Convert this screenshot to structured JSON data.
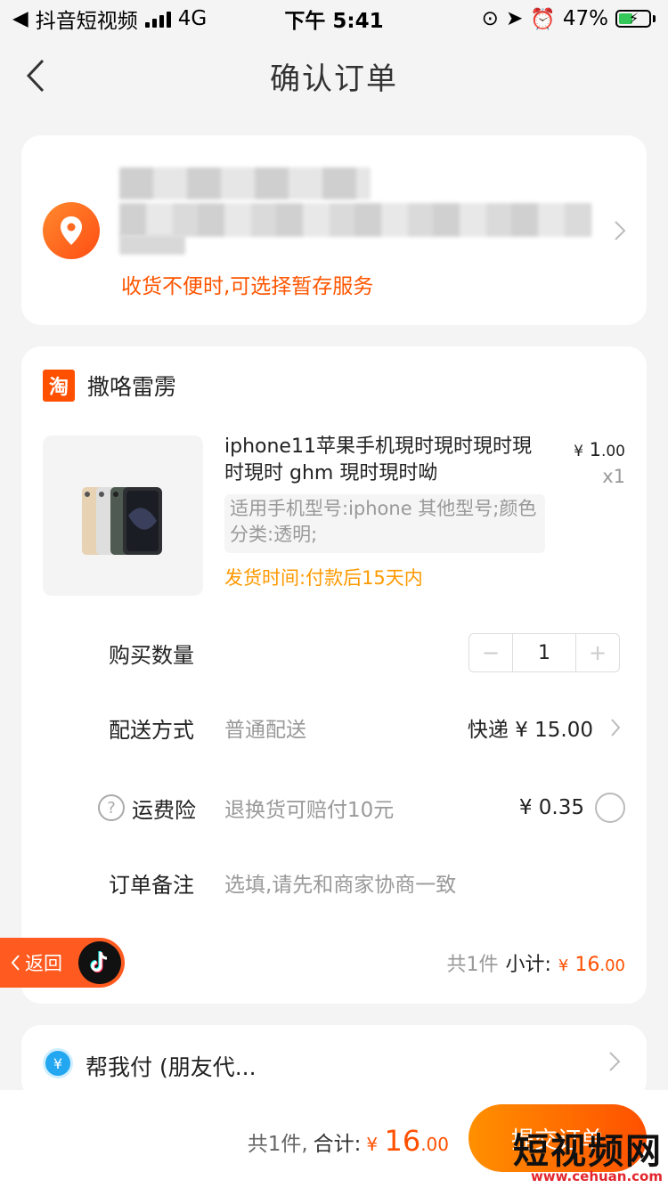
{
  "status_bar": {
    "back_app": "抖音短视频",
    "network": "4G",
    "time": "下午 5:41",
    "battery_pct": "47%",
    "battery_level": 0.47
  },
  "nav": {
    "title": "确认订单"
  },
  "address": {
    "tip": "收货不便时,可选择暂存服务"
  },
  "shop": {
    "logo": "淘",
    "name": "撒咯雷雳"
  },
  "product": {
    "title": "iphone11苹果手机現时現时現时現时現时 ghm 現时現时呦",
    "price_symbol": "¥",
    "price_int": "1",
    "price_dec": ".00",
    "qty_text": "x1",
    "sku": "适用手机型号:iphone 其他型号;颜色分类:透明;",
    "ship_time": "发货时间:付款后15天内"
  },
  "rows": {
    "quantity_label": "购买数量",
    "quantity_value": "1",
    "minus": "−",
    "plus": "+",
    "delivery_label": "配送方式",
    "delivery_sub": "普通配送",
    "delivery_value": "快递 ¥ 15.00",
    "insurance_label": "运费险",
    "insurance_sub": "退换货可赔付10元",
    "insurance_value": "¥ 0.35",
    "note_label": "订单备注",
    "note_placeholder": "选填,请先和商家协商一致"
  },
  "subtotal": {
    "count": "共1件",
    "label": "小计:",
    "symbol": "¥",
    "int": "16",
    "dec": ".00"
  },
  "float_back": {
    "label": "返回"
  },
  "friend_pay": {
    "label": "帮我付 (朋友代..."
  },
  "bottom": {
    "count": "共1件,",
    "label": "合计:",
    "symbol": "¥",
    "int": "16",
    "dec": ".00",
    "submit": "提交订单"
  },
  "watermark": {
    "text": "短视频网",
    "url": "www.cehuan.com"
  },
  "colors": {
    "accent": "#ff5000",
    "ship_time": "#ff9900",
    "bg": "#f4f4f4"
  }
}
